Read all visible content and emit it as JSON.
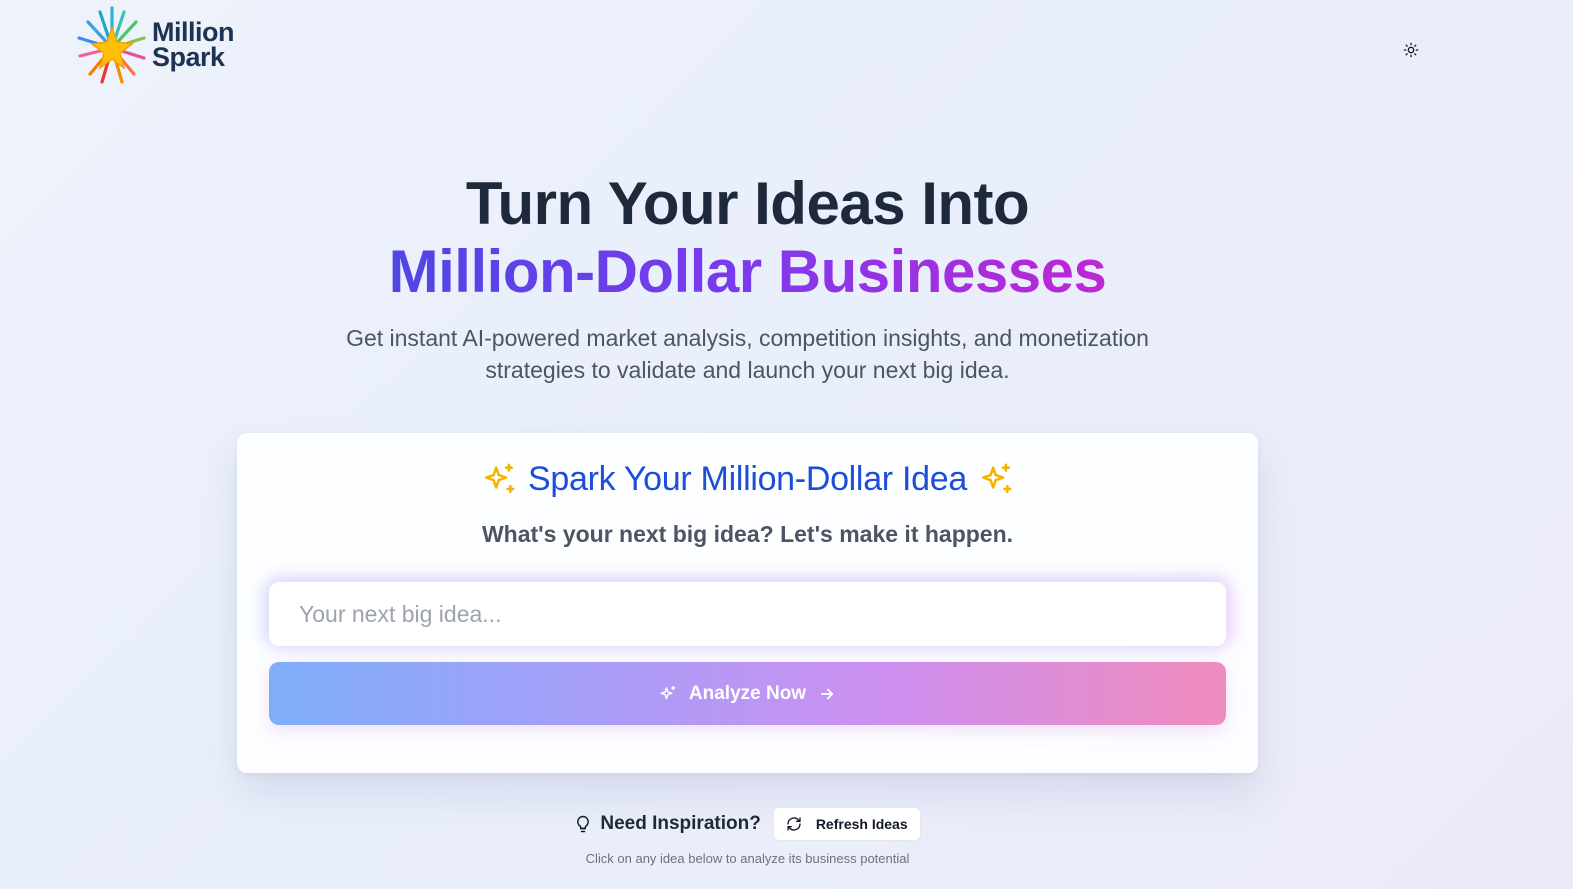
{
  "header": {
    "logo_line1": "Million",
    "logo_line2": "Spark",
    "theme_icon": "sun-icon"
  },
  "hero": {
    "title_line1": "Turn Your Ideas Into",
    "title_line2": "Million-Dollar Businesses",
    "subtitle_line1": "Get instant AI-powered market analysis, competition insights, and monetization",
    "subtitle_line2": "strategies to validate and launch your next big idea."
  },
  "card": {
    "title": "Spark Your Million-Dollar Idea",
    "subtitle": "What's your next big idea? Let's make it happen.",
    "input_placeholder": "Your next big idea...",
    "input_value": "",
    "button_label": "Analyze Now",
    "title_color": "#1d4ed8",
    "sparkle_color": "#f5b400"
  },
  "inspiration": {
    "label": "Need Inspiration?",
    "refresh_label": "Refresh Ideas",
    "hint": "Click on any idea below to analyze its business potential"
  }
}
